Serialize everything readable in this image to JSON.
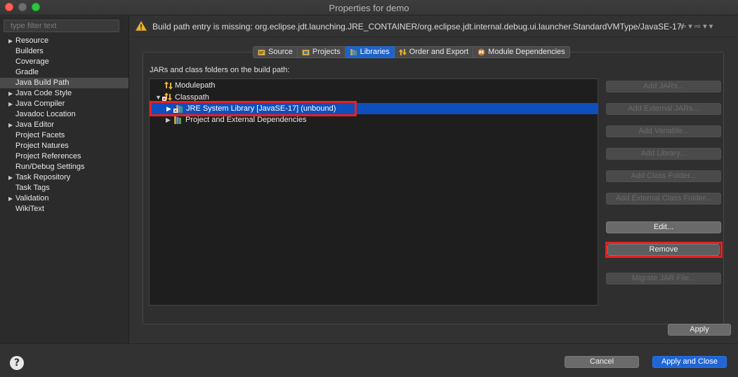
{
  "window": {
    "title": "Properties for demo"
  },
  "filter": {
    "placeholder": "type filter text"
  },
  "sidebar": {
    "items": [
      {
        "label": "Resource",
        "expandable": true
      },
      {
        "label": "Builders",
        "expandable": false
      },
      {
        "label": "Coverage",
        "expandable": false
      },
      {
        "label": "Gradle",
        "expandable": false
      },
      {
        "label": "Java Build Path",
        "expandable": false,
        "selected": true
      },
      {
        "label": "Java Code Style",
        "expandable": true
      },
      {
        "label": "Java Compiler",
        "expandable": true
      },
      {
        "label": "Javadoc Location",
        "expandable": false
      },
      {
        "label": "Java Editor",
        "expandable": true
      },
      {
        "label": "Project Facets",
        "expandable": false
      },
      {
        "label": "Project Natures",
        "expandable": false
      },
      {
        "label": "Project References",
        "expandable": false
      },
      {
        "label": "Run/Debug Settings",
        "expandable": false
      },
      {
        "label": "Task Repository",
        "expandable": true
      },
      {
        "label": "Task Tags",
        "expandable": false
      },
      {
        "label": "Validation",
        "expandable": true
      },
      {
        "label": "WikiText",
        "expandable": false
      }
    ]
  },
  "warning": {
    "message": "Build path entry is missing: org.eclipse.jdt.launching.JRE_CONTAINER/org.eclipse.jdt.internal.debug.ui.launcher.StandardVMType/JavaSE-17/",
    "nav": "⇦ ▾  ⇨ ▾ ▾"
  },
  "tabs": [
    {
      "label": "Source",
      "active": false
    },
    {
      "label": "Projects",
      "active": false
    },
    {
      "label": "Libraries",
      "active": true
    },
    {
      "label": "Order and Export",
      "active": false
    },
    {
      "label": "Module Dependencies",
      "active": false
    }
  ],
  "libraries": {
    "section_label": "JARs and class folders on the build path:",
    "tree": {
      "modulepath": "Modulepath",
      "classpath": "Classpath",
      "jre": "JRE System Library [JavaSE-17] (unbound)",
      "project_deps": "Project and External Dependencies"
    }
  },
  "buttons": {
    "add_jars": "Add JARs...",
    "add_external_jars": "Add External JARs...",
    "add_variable": "Add Variable...",
    "add_library": "Add Library...",
    "add_class_folder": "Add Class Folder...",
    "add_external_class_folder": "Add External Class Folder...",
    "edit": "Edit...",
    "remove": "Remove",
    "migrate_jar": "Migrate JAR File...",
    "apply": "Apply",
    "cancel": "Cancel",
    "apply_and_close": "Apply and Close"
  },
  "help": {
    "glyph": "?"
  },
  "colors": {
    "accent": "#1f66d6",
    "highlight_frame": "#e82020",
    "selection": "#0f4fbd"
  }
}
